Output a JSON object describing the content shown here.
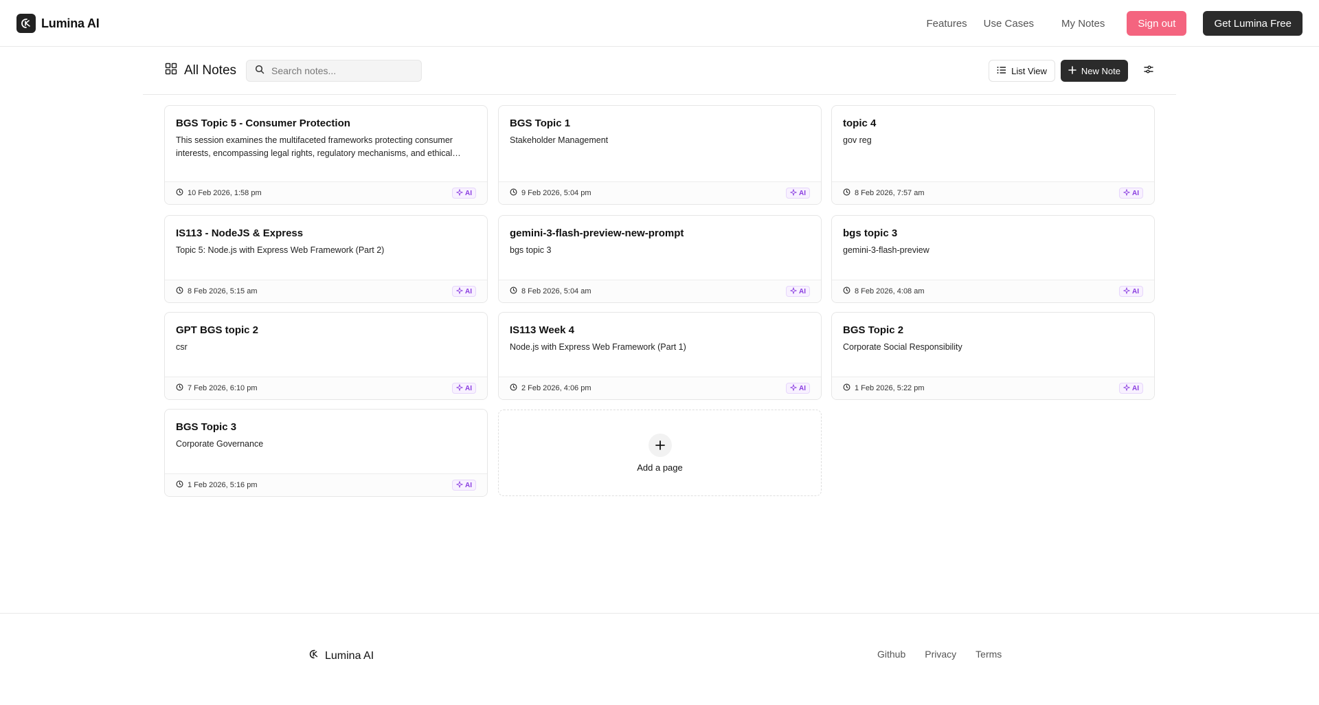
{
  "header": {
    "brand": "Lumina AI",
    "nav": {
      "features": "Features",
      "use_cases": "Use Cases",
      "my_notes": "My Notes"
    },
    "sign_out": "Sign out",
    "get_free": "Get Lumina Free",
    "accent_color": "#f4647f"
  },
  "toolbar": {
    "title": "All Notes",
    "search_placeholder": "Search notes...",
    "list_view": "List View",
    "new_note": "New Note"
  },
  "notes": [
    {
      "title": "BGS Topic 5 - Consumer Protection",
      "desc": "This session examines the multifaceted frameworks protecting consumer interests, encompassing legal rights, regulatory mechanisms, and ethical considerations in modern markets.",
      "date": "10 Feb 2026, 1:58 pm",
      "badge": "AI"
    },
    {
      "title": "BGS Topic 1",
      "desc": "Stakeholder Management",
      "date": "9 Feb 2026, 5:04 pm",
      "badge": "AI"
    },
    {
      "title": "topic 4",
      "desc": "gov reg",
      "date": "8 Feb 2026, 7:57 am",
      "badge": "AI"
    },
    {
      "title": "IS113 - NodeJS & Express",
      "desc": "Topic 5: Node.js with Express Web Framework (Part 2)",
      "date": "8 Feb 2026, 5:15 am",
      "badge": "AI"
    },
    {
      "title": "gemini-3-flash-preview-new-prompt",
      "desc": "bgs topic 3",
      "date": "8 Feb 2026, 5:04 am",
      "badge": "AI"
    },
    {
      "title": "bgs topic 3",
      "desc": "gemini-3-flash-preview",
      "date": "8 Feb 2026, 4:08 am",
      "badge": "AI"
    },
    {
      "title": "GPT BGS topic 2",
      "desc": "csr",
      "date": "7 Feb 2026, 6:10 pm",
      "badge": "AI"
    },
    {
      "title": "IS113 Week 4",
      "desc": "Node.js with Express Web Framework (Part 1)",
      "date": "2 Feb 2026, 4:06 pm",
      "badge": "AI"
    },
    {
      "title": "BGS Topic 2",
      "desc": "Corporate Social Responsibility",
      "date": "1 Feb 2026, 5:22 pm",
      "badge": "AI"
    },
    {
      "title": "BGS Topic 3",
      "desc": "Corporate Governance",
      "date": "1 Feb 2026, 5:16 pm",
      "badge": "AI"
    }
  ],
  "add_page": "Add a page",
  "footer": {
    "brand": "Lumina AI",
    "links": {
      "github": "Github",
      "privacy": "Privacy",
      "terms": "Terms"
    }
  },
  "icons": {
    "logo": "lumina-logo-icon",
    "grid": "grid-icon",
    "search": "search-icon",
    "list": "list-icon",
    "plus": "plus-icon",
    "filter": "filter-icon",
    "clock": "clock-icon",
    "sparkle": "sparkle-icon"
  }
}
